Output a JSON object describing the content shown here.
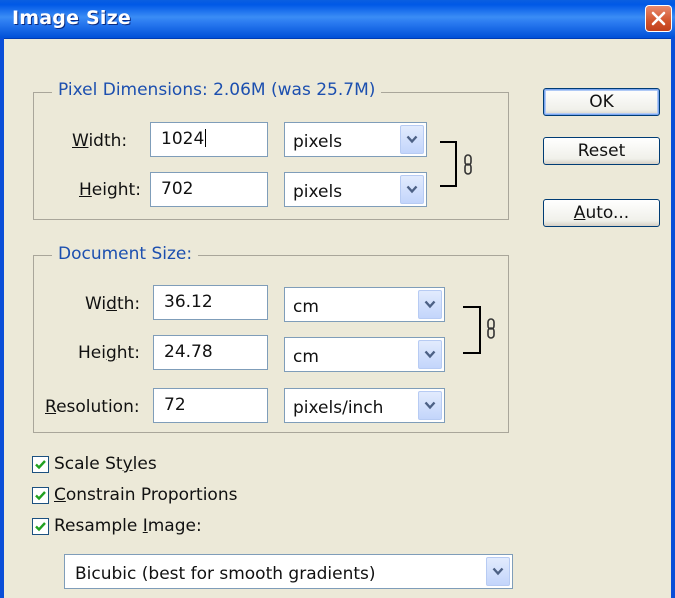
{
  "window": {
    "title": "Image Size"
  },
  "pixel_dimensions": {
    "legend": "Pixel Dimensions:  2.06M (was 25.7M)",
    "width_label": "Width:",
    "width_value": "1024",
    "width_unit": "pixels",
    "height_label": "Height:",
    "height_value": "702",
    "height_unit": "pixels"
  },
  "document_size": {
    "legend": "Document Size:",
    "width_label": "Width:",
    "width_value": "36.12",
    "width_unit": "cm",
    "height_label": "Height:",
    "height_value": "24.78",
    "height_unit": "cm",
    "resolution_label": "Resolution:",
    "resolution_value": "72",
    "resolution_unit": "pixels/inch"
  },
  "buttons": {
    "ok": "OK",
    "reset": "Reset",
    "auto": "Auto..."
  },
  "options": {
    "scale_styles": {
      "label": "Scale Styles",
      "checked": true
    },
    "constrain_proportions": {
      "label": "Constrain Proportions",
      "checked": true
    },
    "resample_image": {
      "label": "Resample Image:",
      "checked": true
    },
    "resample_method": "Bicubic (best for smooth gradients)"
  },
  "icons": [
    "close-icon",
    "chain-link-icon",
    "chevron-down-icon",
    "checkmark-icon"
  ]
}
